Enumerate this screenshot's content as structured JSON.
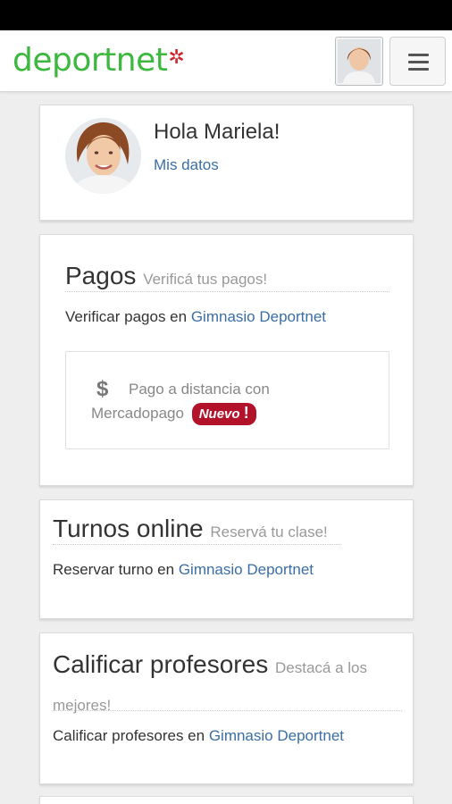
{
  "header": {
    "logo_text": "deportnet",
    "logo_mark": "✲",
    "menu_icon": "hamburger-icon",
    "avatar_icon": "user-avatar"
  },
  "profile": {
    "greeting": "Hola Mariela!",
    "link": "Mis datos"
  },
  "pagos": {
    "title": "Pagos",
    "subtitle": "Verificá tus pagos!",
    "line_prefix": "Verificar pagos en",
    "line_link": "Gimnasio Deportnet",
    "mp_icon": "$",
    "mp_text_1": "Pago a distancia con",
    "mp_text_2": "Mercadopago",
    "badge": "Nuevo",
    "badge_mark": "!"
  },
  "turnos": {
    "title": "Turnos online",
    "subtitle": "Reservá tu clase!",
    "line_prefix": "Reservar turno en",
    "line_link": "Gimnasio Deportnet"
  },
  "calificar": {
    "title": "Calificar profesores",
    "subtitle": "Destacá a los mejores!",
    "line_prefix": "Calificar profesores en",
    "line_link": "Gimnasio Deportnet"
  },
  "colors": {
    "brand_green": "#3cb83e",
    "brand_red": "#d2232a",
    "link_blue": "#3a6ea5",
    "badge_red": "#b3122b"
  }
}
